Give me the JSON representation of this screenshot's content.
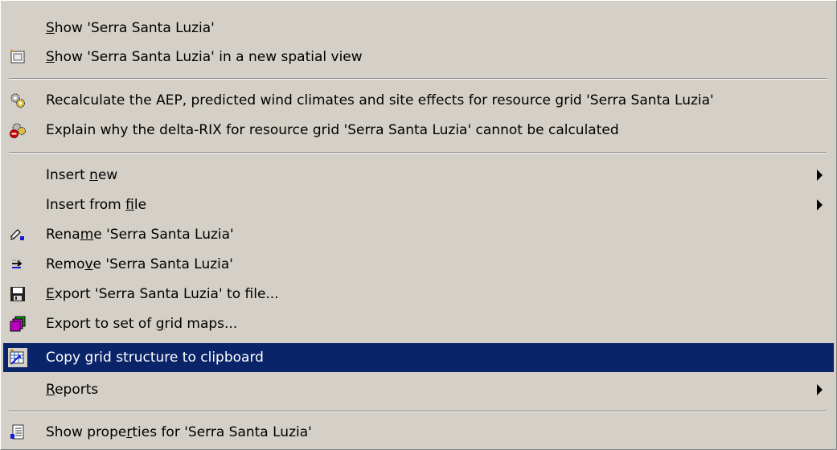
{
  "menu": {
    "items": [
      {
        "id": "show",
        "pre": "",
        "ul": "S",
        "post": "how 'Serra Santa Luzia'",
        "icon": null,
        "submenu": false,
        "selected": false
      },
      {
        "id": "show-spatial",
        "pre": "",
        "ul": "S",
        "post": "how 'Serra Santa Luzia' in a new spatial view",
        "icon": "spatial-view-icon",
        "submenu": false,
        "selected": false
      },
      {
        "id": "recalculate",
        "pre": "Recalculate the AEP, predicted wind climates and site effects for resource grid 'Serra Santa Luzia'",
        "ul": "",
        "post": "",
        "icon": "gears-icon",
        "submenu": false,
        "selected": false
      },
      {
        "id": "explain",
        "pre": "Explain why the delta-RIX for resource grid 'Serra Santa Luzia' cannot be calculated",
        "ul": "",
        "post": "",
        "icon": "gears-error-icon",
        "submenu": false,
        "selected": false
      },
      {
        "id": "insert-new",
        "pre": "Insert ",
        "ul": "n",
        "post": "ew",
        "icon": null,
        "submenu": true,
        "selected": false
      },
      {
        "id": "insert-file",
        "pre": "Insert from ",
        "ul": "f",
        "post": "ile",
        "icon": null,
        "submenu": true,
        "selected": false
      },
      {
        "id": "rename",
        "pre": "Rena",
        "ul": "m",
        "post": "e 'Serra Santa Luzia'",
        "icon": "rename-icon",
        "submenu": false,
        "selected": false
      },
      {
        "id": "remove",
        "pre": "Remo",
        "ul": "v",
        "post": "e 'Serra Santa Luzia'",
        "icon": "remove-icon",
        "submenu": false,
        "selected": false
      },
      {
        "id": "export-file",
        "pre": "",
        "ul": "E",
        "post": "xport 'Serra Santa Luzia' to file...",
        "icon": "save-icon",
        "submenu": false,
        "selected": false
      },
      {
        "id": "export-grid",
        "pre": "Export to set of ",
        "ul": "g",
        "post": "rid maps...",
        "icon": "grid-maps-icon",
        "submenu": false,
        "selected": false
      },
      {
        "id": "copy-grid",
        "pre": "Copy grid structure to clipboard",
        "ul": "",
        "post": "",
        "icon": "copy-grid-icon",
        "submenu": false,
        "selected": true
      },
      {
        "id": "reports",
        "pre": "",
        "ul": "R",
        "post": "eports",
        "icon": null,
        "submenu": true,
        "selected": false
      },
      {
        "id": "properties",
        "pre": "Show prope",
        "ul": "r",
        "post": "ties for 'Serra Santa Luzia'",
        "icon": "properties-icon",
        "submenu": false,
        "selected": false
      }
    ]
  },
  "colors": {
    "menu_bg": "#d4d0c8",
    "highlight": "#0a246a",
    "highlight_text": "#ffffff"
  }
}
